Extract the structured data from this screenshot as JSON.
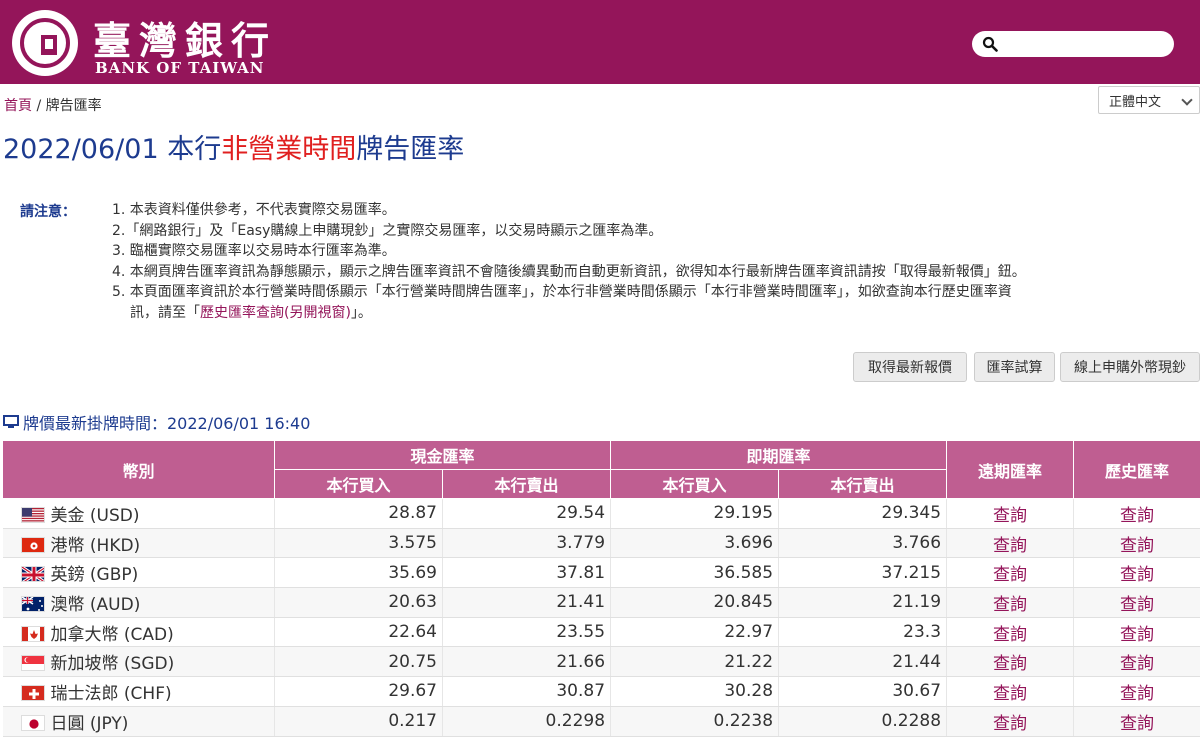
{
  "header": {
    "brand_cn": "臺灣銀行",
    "brand_en": "BANK OF TAIWAN",
    "search_placeholder": ""
  },
  "breadcrumb": {
    "home": "首頁",
    "separator": " / ",
    "current": "牌告匯率"
  },
  "language": {
    "selected": "正體中文"
  },
  "title": {
    "prefix": "2022/06/01 本行",
    "highlight": "非營業時間",
    "suffix": "牌告匯率"
  },
  "notes": {
    "label": "請注意：",
    "items": [
      "1. 本表資料僅供參考，不代表實際交易匯率。",
      "2.「網路銀行」及「Easy購線上申購現鈔」之實際交易匯率，以交易時顯示之匯率為準。",
      "3. 臨櫃實際交易匯率以交易時本行匯率為準。",
      "4. 本網頁牌告匯率資訊為靜態顯示，顯示之牌告匯率資訊不會隨後續異動而自動更新資訊，欲得知本行最新牌告匯率資訊請按「取得最新報價」鈕。",
      "5. 本頁面匯率資訊於本行營業時間係顯示「本行營業時間牌告匯率」，於本行非營業時間係顯示「本行非營業時間匯率」，如欲查詢本行歷史匯率資"
    ],
    "item5_cont_prefix": "訊，請至「",
    "item5_link": "歷史匯率查詢(另開視窗)",
    "item5_cont_suffix": "」。"
  },
  "buttons": {
    "latest": "取得最新報價",
    "calc": "匯率試算",
    "online": "線上申購外幣現鈔"
  },
  "quote_time": "牌價最新掛牌時間：2022/06/01 16:40",
  "table": {
    "headers": {
      "currency": "幣別",
      "cash": "現金匯率",
      "spot": "即期匯率",
      "forward": "遠期匯率",
      "history": "歷史匯率",
      "buy": "本行買入",
      "sell": "本行賣出"
    },
    "link_label": "查詢",
    "rows": [
      {
        "flag": "us",
        "name": "美金 (USD)",
        "cash_buy": "28.87",
        "cash_sell": "29.54",
        "spot_buy": "29.195",
        "spot_sell": "29.345"
      },
      {
        "flag": "hk",
        "name": "港幣 (HKD)",
        "cash_buy": "3.575",
        "cash_sell": "3.779",
        "spot_buy": "3.696",
        "spot_sell": "3.766"
      },
      {
        "flag": "gb",
        "name": "英鎊 (GBP)",
        "cash_buy": "35.69",
        "cash_sell": "37.81",
        "spot_buy": "36.585",
        "spot_sell": "37.215"
      },
      {
        "flag": "au",
        "name": "澳幣 (AUD)",
        "cash_buy": "20.63",
        "cash_sell": "21.41",
        "spot_buy": "20.845",
        "spot_sell": "21.19"
      },
      {
        "flag": "ca",
        "name": "加拿大幣 (CAD)",
        "cash_buy": "22.64",
        "cash_sell": "23.55",
        "spot_buy": "22.97",
        "spot_sell": "23.3"
      },
      {
        "flag": "sg",
        "name": "新加坡幣 (SGD)",
        "cash_buy": "20.75",
        "cash_sell": "21.66",
        "spot_buy": "21.22",
        "spot_sell": "21.44"
      },
      {
        "flag": "ch",
        "name": "瑞士法郎 (CHF)",
        "cash_buy": "29.67",
        "cash_sell": "30.87",
        "spot_buy": "30.28",
        "spot_sell": "30.67"
      },
      {
        "flag": "jp",
        "name": "日圓 (JPY)",
        "cash_buy": "0.217",
        "cash_sell": "0.2298",
        "spot_buy": "0.2238",
        "spot_sell": "0.2288"
      }
    ]
  },
  "colors": {
    "brand": "#94155a",
    "table_header": "#bf5e91",
    "title_blue": "#1d3b8f",
    "highlight_red": "#e02020"
  }
}
